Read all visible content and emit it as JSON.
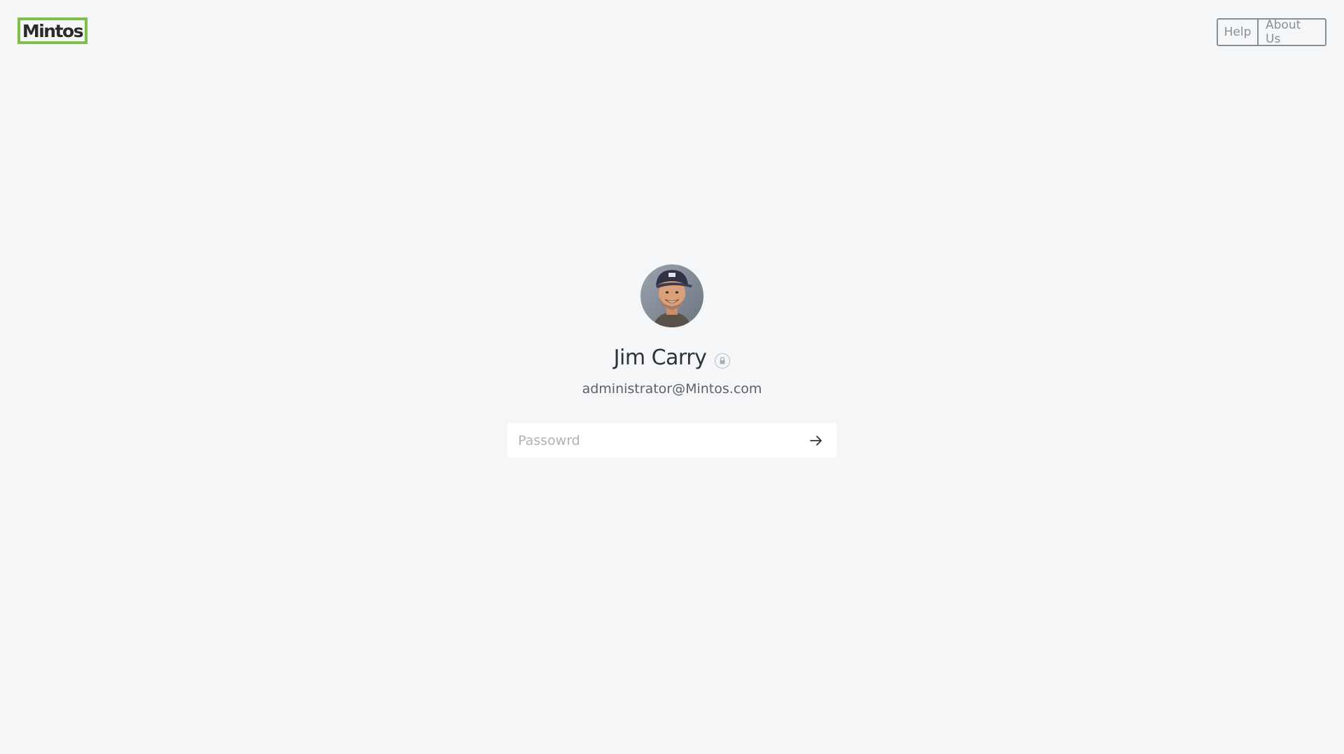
{
  "brand": {
    "name": "Mintos",
    "border_color": "#7dc142"
  },
  "top_nav": {
    "help_label": "Help",
    "about_label": "About Us"
  },
  "lock_screen": {
    "user_name": "Jim Carry",
    "email": "administrator@Mintos.com",
    "lock_icon": "lock-icon",
    "avatar_icon": "user-avatar",
    "password": {
      "placeholder": "Passowrd",
      "value": ""
    },
    "submit_icon": "arrow-right-icon"
  },
  "colors": {
    "background": "#f4f6f8",
    "text": "#2f3337",
    "muted": "#8a8f94"
  }
}
